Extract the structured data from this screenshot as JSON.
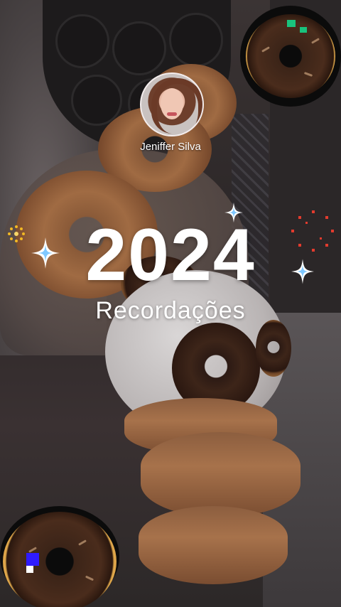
{
  "profile": {
    "name": "Jeniffer Silva"
  },
  "title": {
    "year": "2024",
    "subtitle": "Recordações"
  },
  "decorations": {
    "stickers": [
      "donut-sticker",
      "donut-sticker"
    ],
    "sparkles": [
      "sparkle-icon",
      "sparkle-icon",
      "sparkle-icon"
    ],
    "fireworks": [
      "firework-icon",
      "firework-icon"
    ]
  },
  "colors": {
    "text": "#ffffff",
    "firework_red": "#e23b2e",
    "firework_yellow": "#f2b824",
    "pixel_green": "#19c37d",
    "pixel_blue": "#2f1bff"
  }
}
